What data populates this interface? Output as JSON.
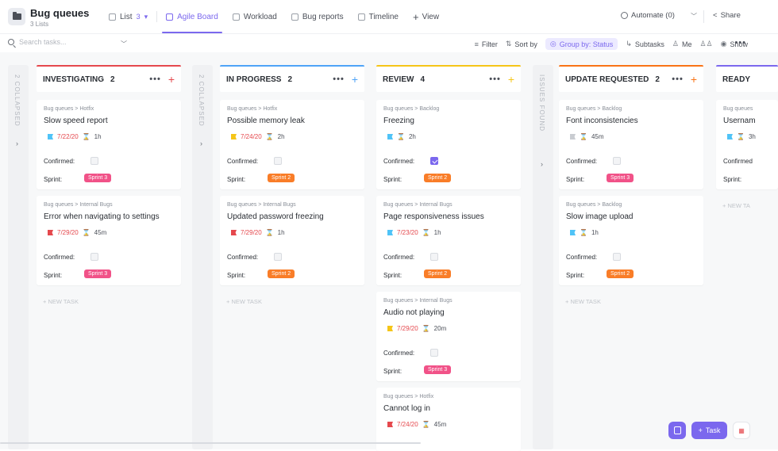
{
  "header": {
    "title": "Bug queues",
    "subtitle": "3 Lists"
  },
  "views": [
    {
      "label": "List",
      "count": "3",
      "active": false
    },
    {
      "label": "Agile Board",
      "active": true
    },
    {
      "label": "Workload",
      "active": false
    },
    {
      "label": "Bug reports",
      "active": false
    },
    {
      "label": "Timeline",
      "active": false
    }
  ],
  "add_view": "View",
  "automate": "Automate (0)",
  "share": "Share",
  "toolbar": {
    "search_placeholder": "Search tasks...",
    "filter": "Filter",
    "sort": "Sort by",
    "group": "Group by: Status",
    "subtasks": "Subtasks",
    "me": "Me",
    "show": "Show"
  },
  "collapsed": [
    {
      "label": "2 COLLAPSED"
    },
    {
      "label": "2 COLLAPSED"
    },
    {
      "label": "ISSUES FOUND"
    }
  ],
  "columns": [
    {
      "name": "INVESTIGATING",
      "count": "2",
      "color": "#e5484d",
      "cards": [
        {
          "crumb": "Bug queues  >  Hotfix",
          "title": "Slow speed report",
          "flag": "#4fc3f7",
          "date": "7/22/20",
          "est": "1h",
          "confirmed_label": "Confirmed:",
          "confirmed": false,
          "sprint_label": "Sprint:",
          "sprint": "Sprint 3",
          "sprint_color": "#f0447e"
        },
        {
          "crumb": "Bug queues  >  Internal Bugs",
          "title": "Error when navigating to settings",
          "flag": "#e5484d",
          "date": "7/29/20",
          "est": "45m",
          "confirmed_label": "Confirmed:",
          "confirmed": false,
          "sprint_label": "Sprint:",
          "sprint": "Sprint 3",
          "sprint_color": "#f0447e"
        }
      ],
      "newtask": "+ NEW TASK"
    },
    {
      "name": "IN PROGRESS",
      "count": "2",
      "color": "#4fa3f7",
      "cards": [
        {
          "crumb": "Bug queues  >  Hotfix",
          "title": "Possible memory leak",
          "flag": "#f5c518",
          "date": "7/24/20",
          "est": "2h",
          "confirmed_label": "Confirmed:",
          "confirmed": false,
          "sprint_label": "Sprint:",
          "sprint": "Sprint 2",
          "sprint_color": "#f97316"
        },
        {
          "crumb": "Bug queues  >  Internal Bugs",
          "title": "Updated password freezing",
          "flag": "#e5484d",
          "date": "7/29/20",
          "est": "1h",
          "confirmed_label": "Confirmed:",
          "confirmed": false,
          "sprint_label": "Sprint:",
          "sprint": "Sprint 2",
          "sprint_color": "#f97316"
        }
      ],
      "newtask": "+ NEW TASK"
    },
    {
      "name": "REVIEW",
      "count": "4",
      "color": "#f5c518",
      "cards": [
        {
          "crumb": "Bug queues  >  Backlog",
          "title": "Freezing",
          "flag": "#4fc3f7",
          "date": "",
          "est": "2h",
          "confirmed_label": "Confirmed:",
          "confirmed": true,
          "sprint_label": "Sprint:",
          "sprint": "Sprint 2",
          "sprint_color": "#f97316"
        },
        {
          "crumb": "Bug queues  >  Internal Bugs",
          "title": "Page responsiveness issues",
          "flag": "#4fc3f7",
          "date": "7/23/20",
          "est": "1h",
          "confirmed_label": "Confirmed:",
          "confirmed": false,
          "sprint_label": "Sprint:",
          "sprint": "Sprint 2",
          "sprint_color": "#f97316"
        },
        {
          "crumb": "Bug queues  >  Internal Bugs",
          "title": "Audio not playing",
          "flag": "#f5c518",
          "date": "7/29/20",
          "est": "20m",
          "confirmed_label": "Confirmed:",
          "confirmed": false,
          "sprint_label": "Sprint:",
          "sprint": "Sprint 3",
          "sprint_color": "#f0447e"
        },
        {
          "crumb": "Bug queues  >  Hotfix",
          "title": "Cannot log in",
          "flag": "#e5484d",
          "date": "7/24/20",
          "est": "45m"
        }
      ]
    },
    {
      "name": "UPDATE REQUESTED",
      "count": "2",
      "color": "#f97316",
      "cards": [
        {
          "crumb": "Bug queues  >  Backlog",
          "title": "Font inconsistencies",
          "flag": "#c9ccd1",
          "date": "",
          "est": "45m",
          "confirmed_label": "Confirmed:",
          "confirmed": false,
          "sprint_label": "Sprint:",
          "sprint": "Sprint 3",
          "sprint_color": "#f0447e"
        },
        {
          "crumb": "Bug queues  >  Backlog",
          "title": "Slow image upload",
          "flag": "#4fc3f7",
          "date": "",
          "est": "1h",
          "confirmed_label": "Confirmed:",
          "confirmed": false,
          "sprint_label": "Sprint:",
          "sprint": "Sprint 2",
          "sprint_color": "#f97316"
        }
      ],
      "newtask": "+ NEW TASK"
    },
    {
      "name": "READY",
      "count": "",
      "color": "#7b68ee",
      "cards": [
        {
          "crumb": "Bug queues",
          "title": "Usernam",
          "flag": "#4fc3f7",
          "date": "",
          "est": "3h",
          "confirmed_label": "Confirmed",
          "confirmed": null,
          "sprint_label": "Sprint:",
          "sprint": "",
          "sprint_color": ""
        }
      ],
      "newtask": "+ NEW TA"
    }
  ],
  "fab": {
    "task": "Task"
  }
}
